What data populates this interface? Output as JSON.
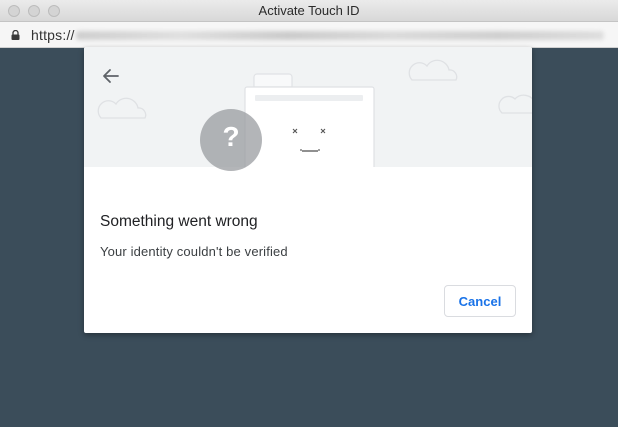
{
  "window": {
    "title": "Activate Touch ID"
  },
  "address_bar": {
    "url_prefix": "https://"
  },
  "dialog": {
    "title": "Something went wrong",
    "message": "Your identity couldn't be verified",
    "cancel_label": "Cancel",
    "illustration_mark": "?",
    "face_mouth": "-—-"
  },
  "colors": {
    "page_background": "#3b4d5a",
    "accent": "#1a73e8",
    "illustration_background": "#f1f3f4",
    "question_circle": "#a6a8ab"
  },
  "icons": [
    "lock-icon",
    "back-arrow-icon",
    "cloud-icon",
    "question-mark-icon",
    "sad-face-icon"
  ]
}
